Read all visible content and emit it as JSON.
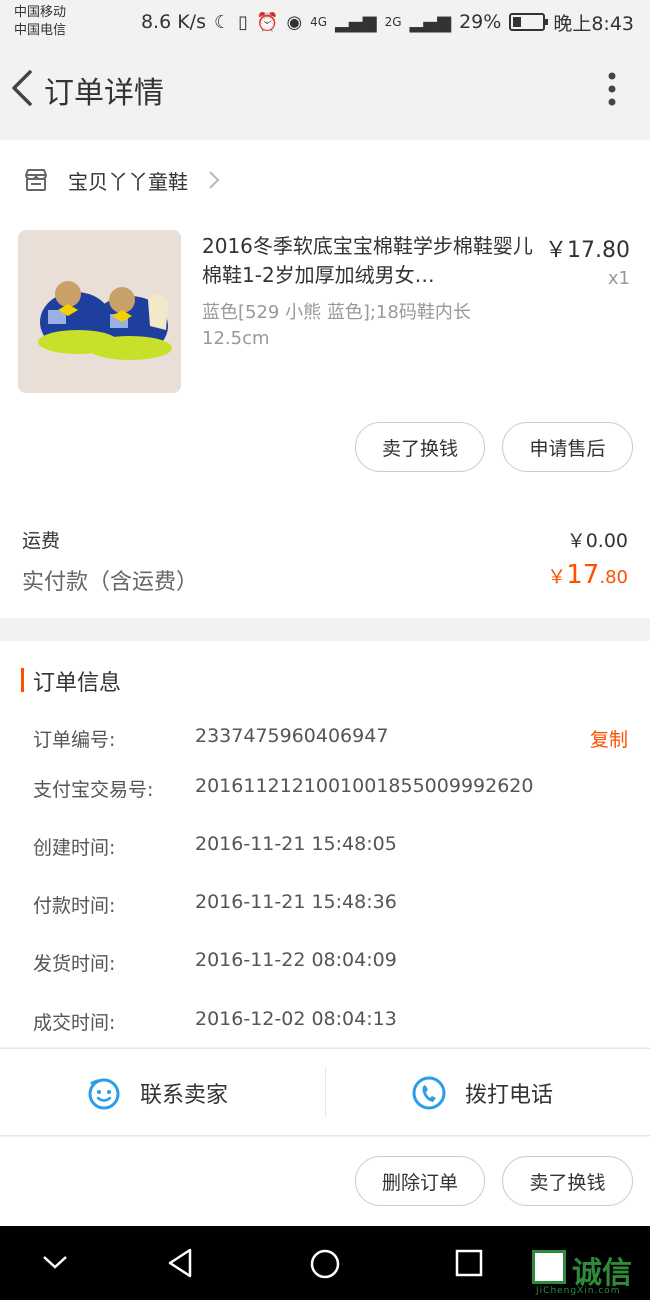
{
  "status_bar": {
    "carrier1": "中国移动",
    "carrier2": "中国电信",
    "net_speed": "8.6 K/s",
    "sig1": "4G",
    "sig2": "2G",
    "battery": "29%",
    "battery_level": 0.29,
    "time": "晚上8:43"
  },
  "nav": {
    "title": "订单详情"
  },
  "shop": {
    "name": "宝贝丫丫童鞋"
  },
  "product": {
    "title": "2016冬季软底宝宝棉鞋学步棉鞋婴儿棉鞋1-2岁加厚加绒男女…",
    "price": "￥17.80",
    "qty": "x1",
    "sku": "蓝色[529 小熊 蓝色];18码鞋内长12.5cm"
  },
  "item_actions": {
    "sell": "卖了换钱",
    "after_sale": "申请售后"
  },
  "fees": {
    "shipping_label": "运费",
    "shipping_value": "￥0.00",
    "paid_label": "实付款（含运费）",
    "paid_currency": "￥",
    "paid_int": "17",
    "paid_dec": ".80"
  },
  "order_info": {
    "title": "订单信息",
    "copy_label": "复制",
    "rows": [
      {
        "label": "订单编号:",
        "value": "2337475960406947"
      },
      {
        "label": "支付宝交易号:",
        "value": "2016112121001001855009992620"
      },
      {
        "label": "创建时间:",
        "value": "2016-11-21 15:48:05"
      },
      {
        "label": "付款时间:",
        "value": "2016-11-21 15:48:36"
      },
      {
        "label": "发货时间:",
        "value": "2016-11-22 08:04:09"
      },
      {
        "label": "成交时间:",
        "value": "2016-12-02 08:04:13"
      }
    ]
  },
  "contact": {
    "seller": "联系卖家",
    "call": "拨打电话"
  },
  "bottom_actions": {
    "delete": "删除订单",
    "sell": "卖了换钱"
  },
  "watermark": {
    "text": "诚信",
    "sub": "JiChengXin.com"
  },
  "colors": {
    "accent": "#ff5000",
    "icon_blue": "#2a9ee8"
  }
}
